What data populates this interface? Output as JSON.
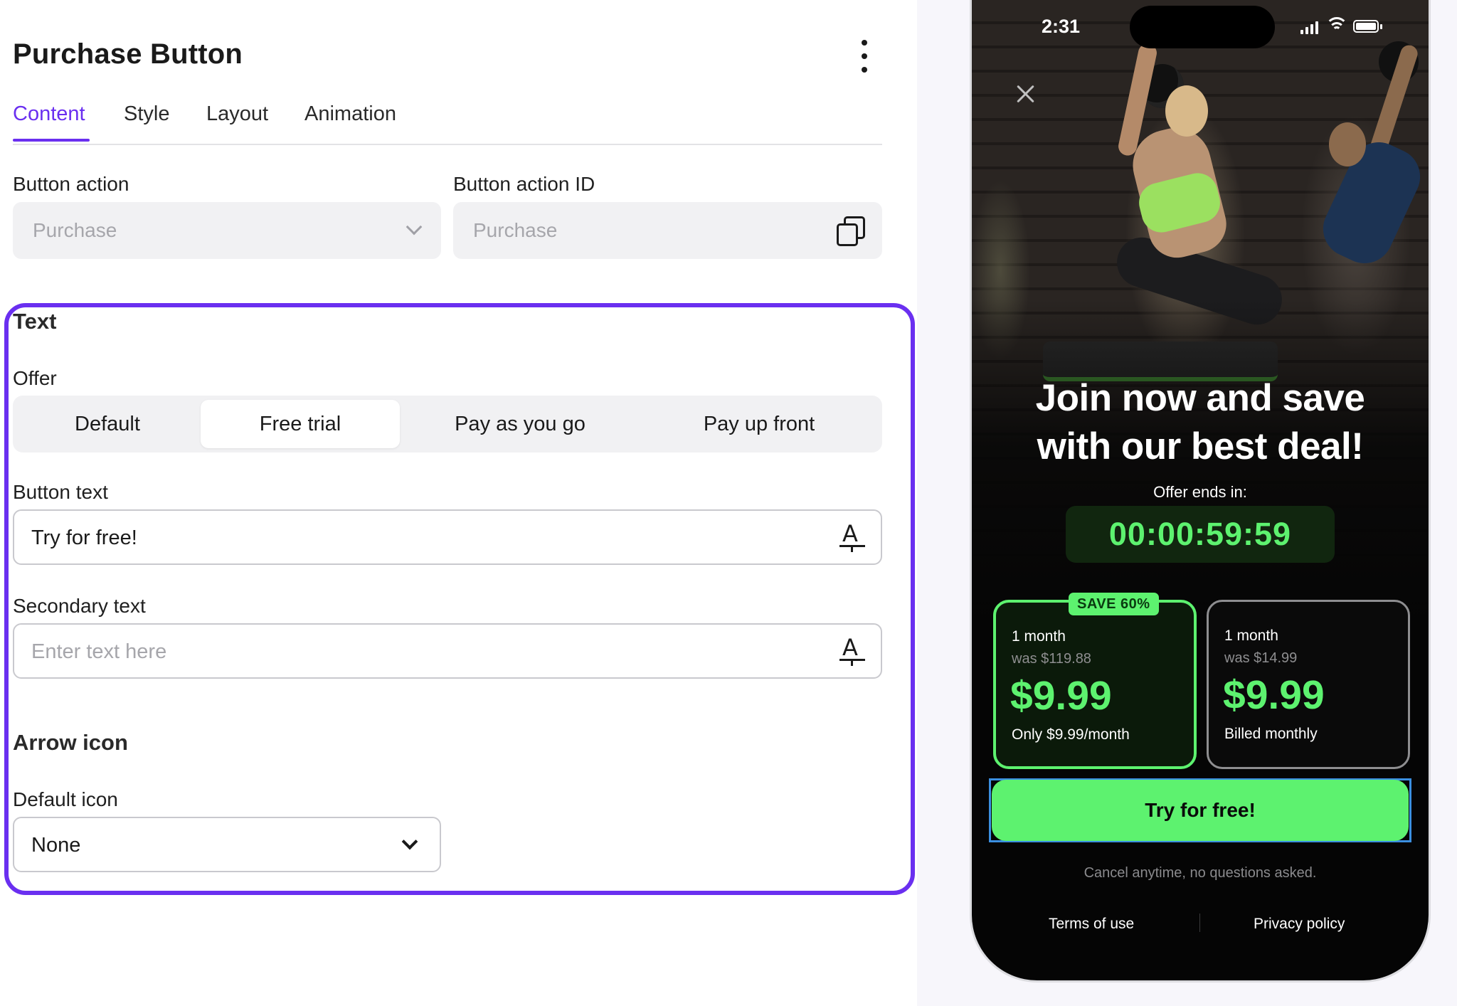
{
  "editor": {
    "title": "Purchase Button",
    "tabs": [
      {
        "label": "Content",
        "active": true
      },
      {
        "label": "Style",
        "active": false
      },
      {
        "label": "Layout",
        "active": false
      },
      {
        "label": "Animation",
        "active": false
      }
    ],
    "button_action": {
      "label": "Button action",
      "value": "Purchase"
    },
    "button_action_id": {
      "label": "Button action ID",
      "value": "Purchase"
    },
    "text_section": {
      "title": "Text",
      "offer_label": "Offer",
      "offer_options": [
        "Default",
        "Free trial",
        "Pay as you go",
        "Pay up front"
      ],
      "offer_selected": "Free trial",
      "button_text": {
        "label": "Button text",
        "value": "Try for free!"
      },
      "secondary_text": {
        "label": "Secondary text",
        "placeholder": "Enter text here"
      }
    },
    "arrow_section": {
      "title": "Arrow icon",
      "default_icon_label": "Default icon",
      "default_icon_value": "None"
    },
    "accent_color": "#6a2ff0"
  },
  "preview": {
    "status": {
      "time": "2:31"
    },
    "headline_line1": "Join now and save",
    "headline_line2": "with our best deal!",
    "offer_ends": "Offer ends in:",
    "timer": "00:00:59:59",
    "plans": [
      {
        "badge": "SAVE 60%",
        "term": "1 month",
        "was": "was $119.88",
        "price": "$9.99",
        "note": "Only $9.99/month",
        "selected": true
      },
      {
        "badge": "",
        "term": "1 month",
        "was": "was $14.99",
        "price": "$9.99",
        "note": "Billed monthly",
        "selected": false
      }
    ],
    "cta": "Try for free!",
    "cancel_note": "Cancel anytime, no questions asked.",
    "footer": {
      "terms": "Terms of use",
      "privacy": "Privacy policy"
    },
    "accent_color": "#5df26f"
  }
}
